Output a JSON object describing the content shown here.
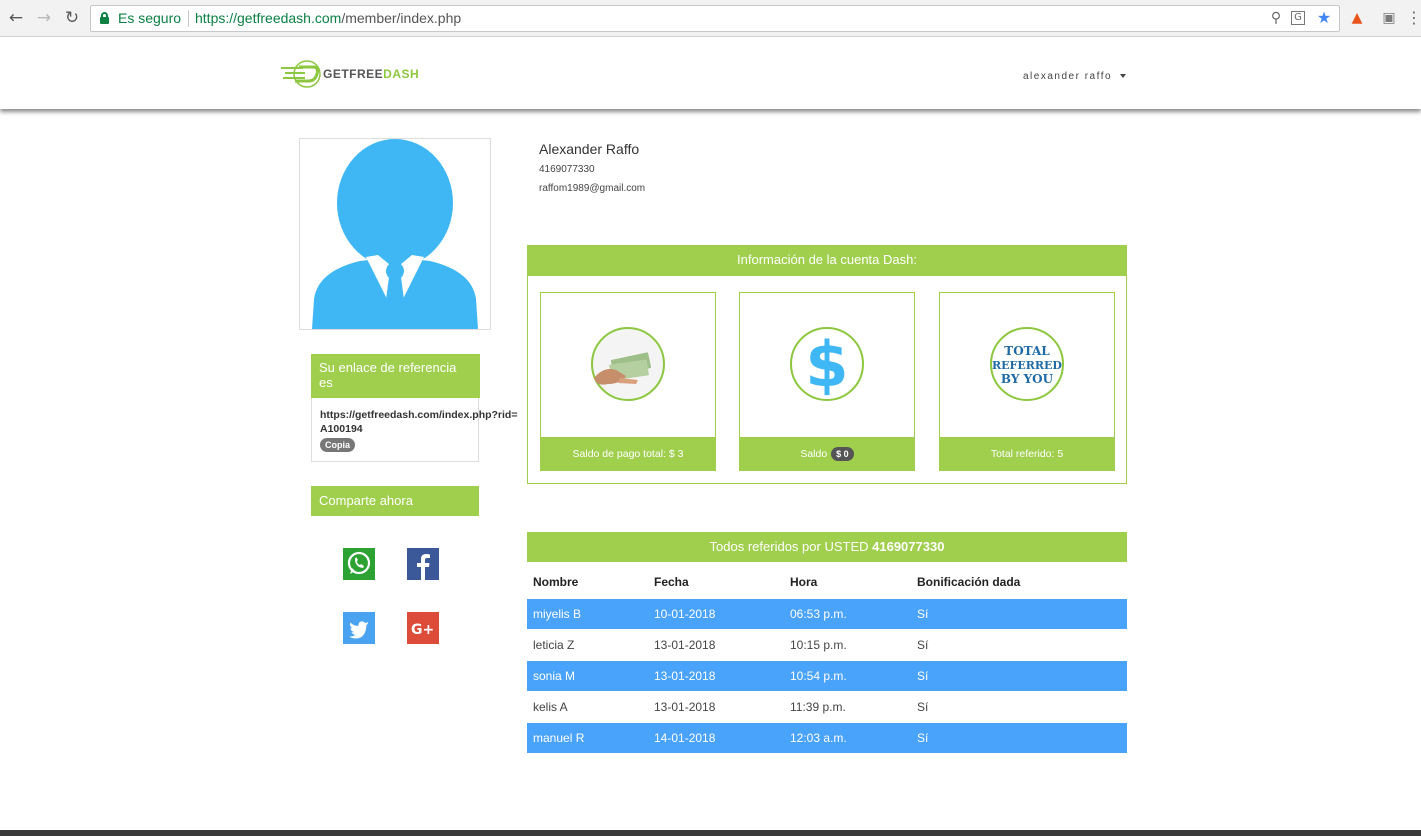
{
  "browser": {
    "secure_label": "Es seguro",
    "url_scheme_host": "https://getfreedash.com",
    "url_path": "/member/index.php"
  },
  "header": {
    "logo_part1": "GETFREE",
    "logo_part2": "DASH",
    "user_name": "alexander raffo"
  },
  "profile": {
    "name": "Alexander Raffo",
    "phone": "4169077330",
    "email": "raffom1989@gmail.com"
  },
  "referral": {
    "title": "Su enlace de referencia es",
    "link": "https://getfreedash.com/index.php?rid=A100194",
    "copy_label": "Copia"
  },
  "share": {
    "title": "Comparte ahora"
  },
  "dash_info": {
    "title": "Información de la cuenta Dash:",
    "cards": [
      {
        "label": "Saldo de pago total: $ 3"
      },
      {
        "label": "Saldo",
        "badge": "$ 0"
      },
      {
        "label": "Total referido: 5",
        "icon_text_1": "TOTAL",
        "icon_text_2": "REFERRED",
        "icon_text_3": "BY YOU"
      }
    ]
  },
  "referrals": {
    "title_prefix": "Todos referidos por USTED",
    "title_id": "4169077330",
    "columns": [
      "Nombre",
      "Fecha",
      "Hora",
      "Bonificación dada"
    ],
    "rows": [
      {
        "name": "miyelis B",
        "date": "10-01-2018",
        "time": "06:53 p.m.",
        "bonus": "Sí"
      },
      {
        "name": "leticia Z",
        "date": "13-01-2018",
        "time": "10:15 p.m.",
        "bonus": "Sí"
      },
      {
        "name": "sonia M",
        "date": "13-01-2018",
        "time": "10:54 p.m.",
        "bonus": "Sí"
      },
      {
        "name": "kelis A",
        "date": "13-01-2018",
        "time": "11:39 p.m.",
        "bonus": "Sí"
      },
      {
        "name": "manuel R",
        "date": "14-01-2018",
        "time": "12:03 a.m.",
        "bonus": "Sí"
      }
    ]
  },
  "colors": {
    "accent_green": "#a0cf4e",
    "row_blue": "#4aa3fb",
    "avatar_blue": "#3fb7f5"
  }
}
